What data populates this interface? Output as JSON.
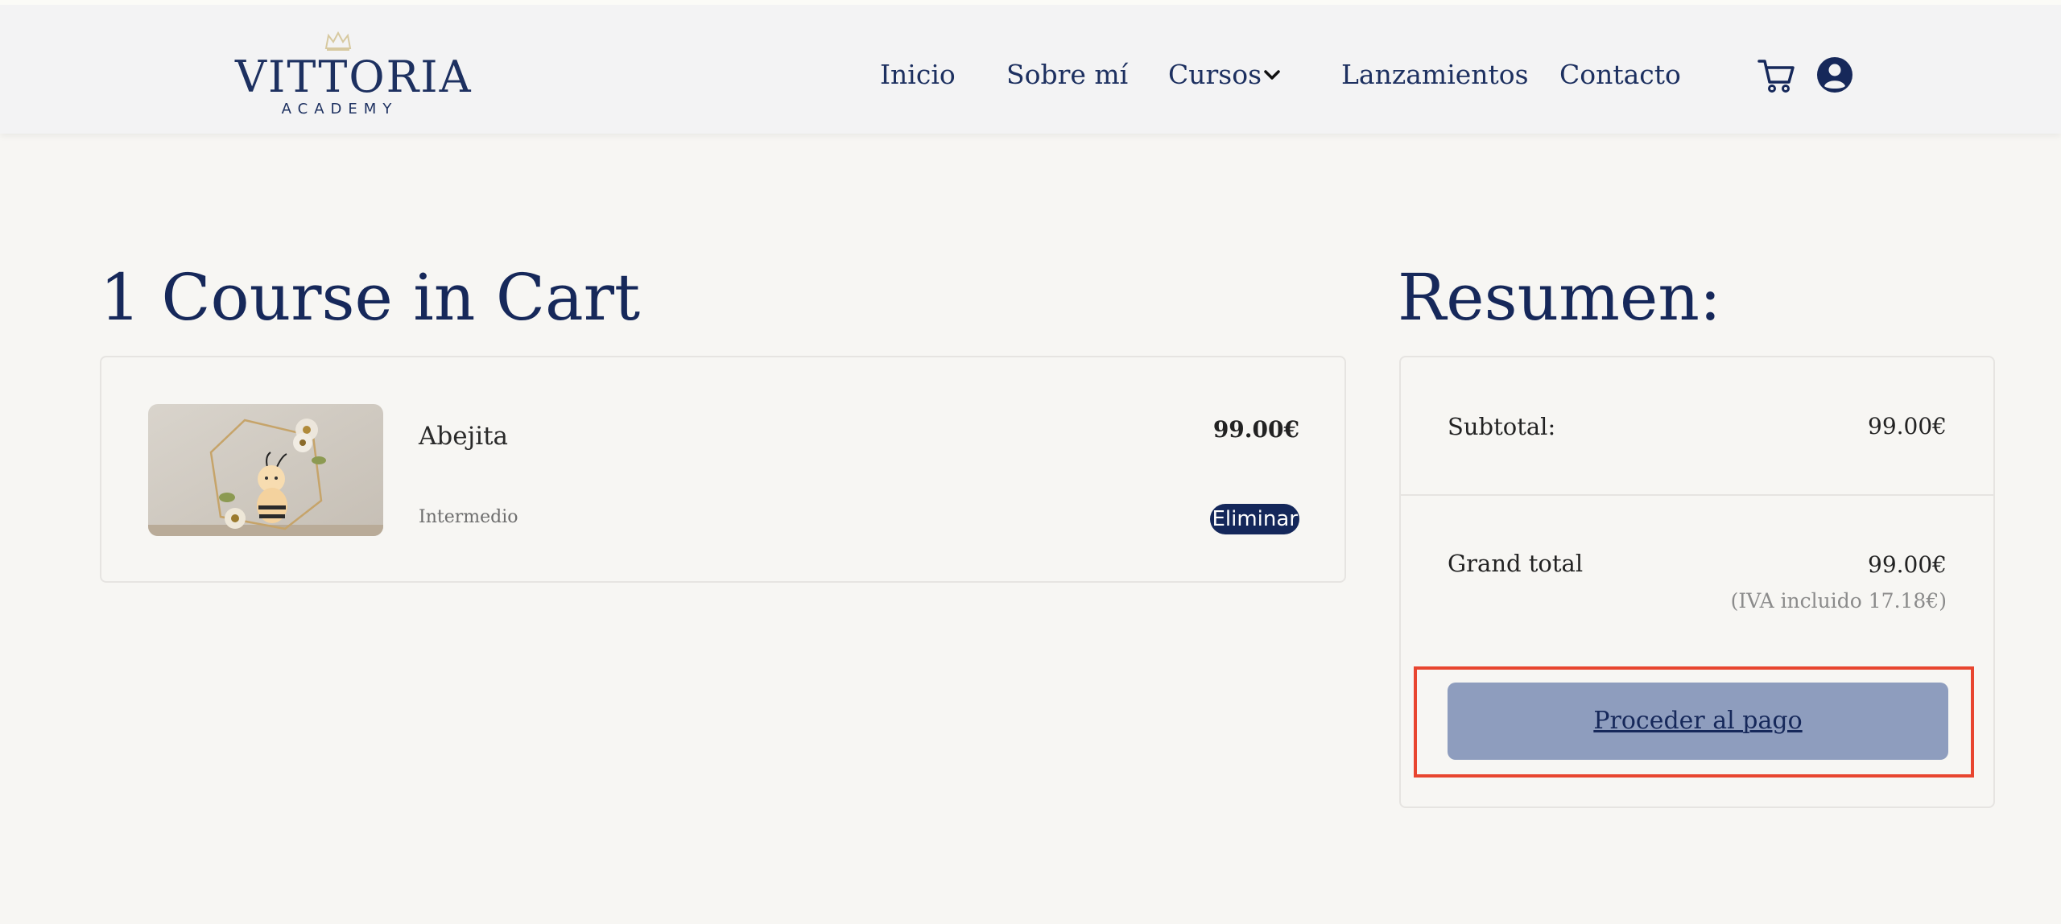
{
  "header": {
    "logo": {
      "title": "VITTORIA",
      "subtitle": "ACADEMY"
    },
    "nav": [
      {
        "label": "Inicio"
      },
      {
        "label": "Sobre mí"
      },
      {
        "label": "Cursos"
      },
      {
        "label": "Lanzamientos"
      },
      {
        "label": "Contacto"
      }
    ],
    "icons": [
      "crown-icon",
      "chevron-down-icon",
      "cart-icon",
      "user-icon"
    ]
  },
  "cart": {
    "title": "1 Course in Cart",
    "items": [
      {
        "name": "Abejita",
        "level": "Intermedio",
        "price": "99.00€",
        "remove_label": "Eliminar"
      }
    ]
  },
  "summary": {
    "title": "Resumen:",
    "subtotal_label": "Subtotal:",
    "subtotal_value": "99.00€",
    "grand_total_label": "Grand total",
    "grand_total_value": "99.00€",
    "tax_note": "(IVA incluido 17.18€)",
    "checkout_label": "Proceder al pago"
  },
  "colors": {
    "brand": "#16285a",
    "background": "#f7f6f3",
    "checkout_button": "#8e9dbe",
    "highlight": "#e8452f"
  }
}
